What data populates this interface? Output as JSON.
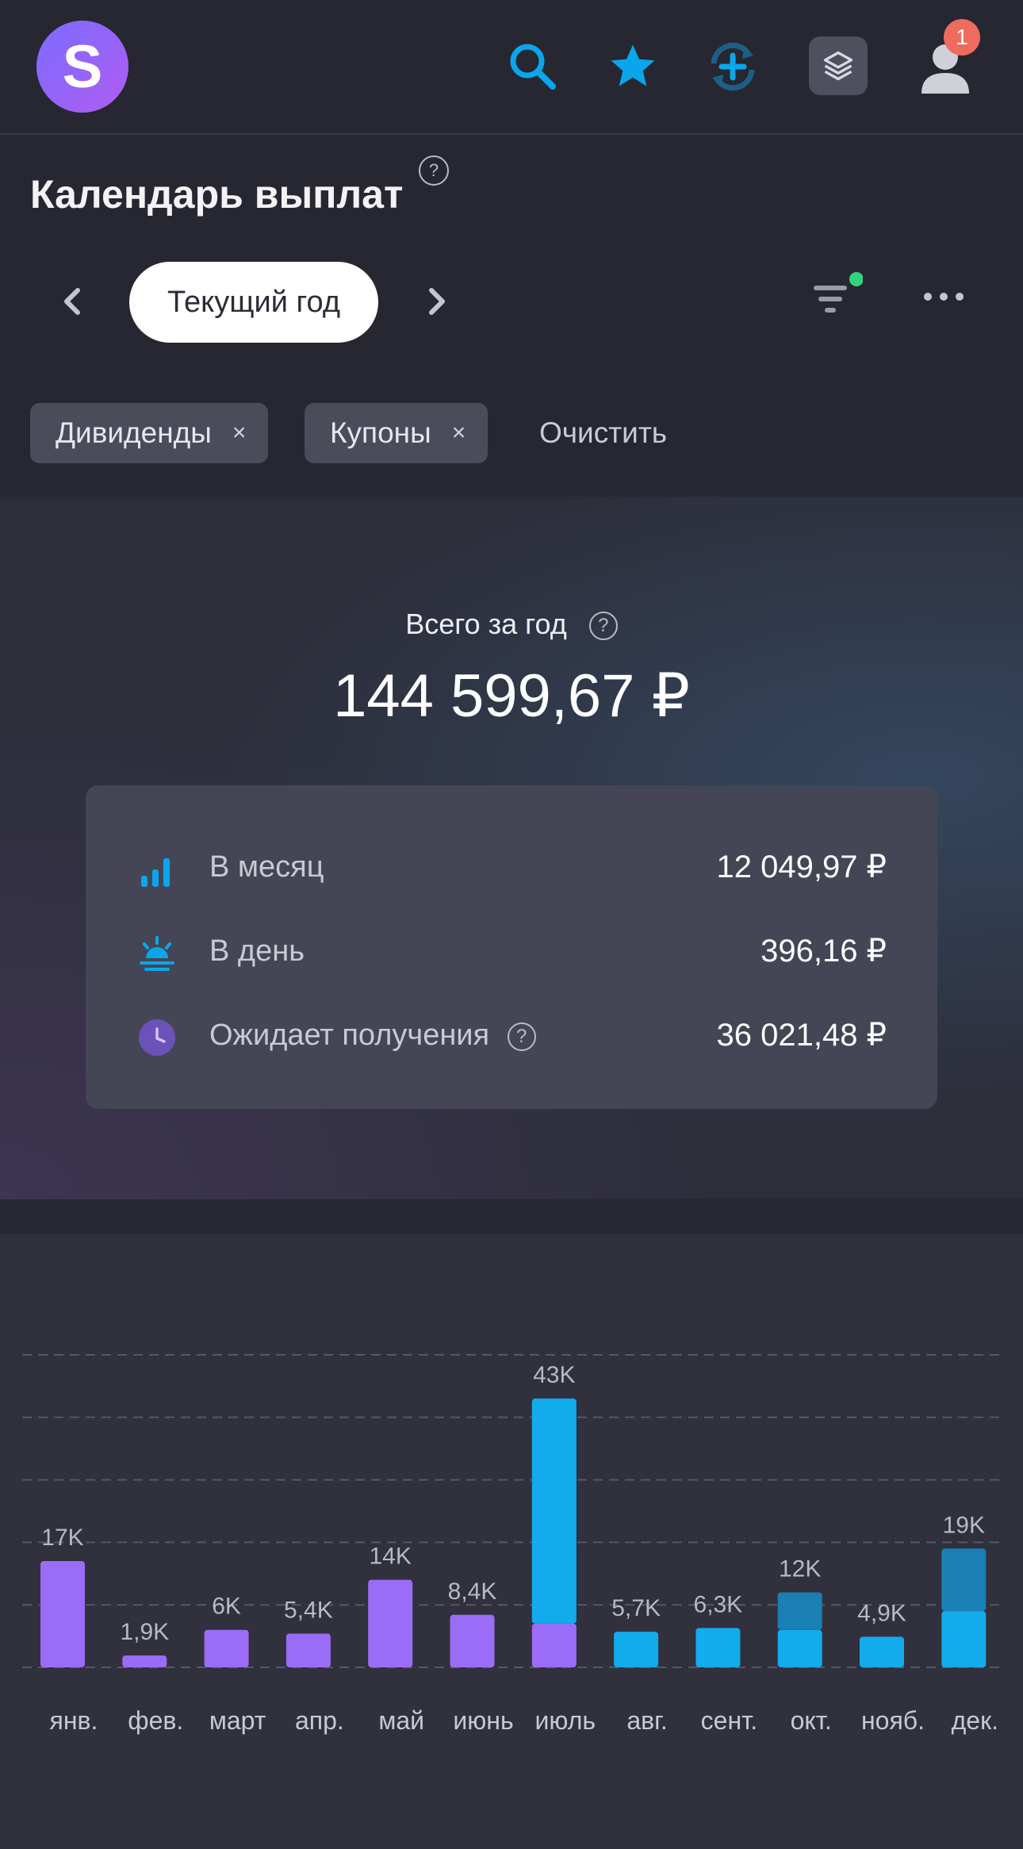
{
  "topbar": {
    "logo_letter": "S",
    "icons": [
      "search-icon",
      "star-icon",
      "add-sync-icon",
      "layers-icon",
      "user-icon"
    ],
    "notification_count": "1",
    "accent": "#0aa6ec"
  },
  "header": {
    "title": "Календарь выплат",
    "help": "?",
    "period": "Текущий год",
    "filter_active_color": "#35d07f"
  },
  "filters": {
    "chips": [
      {
        "label": "Дивиденды",
        "remove": "×"
      },
      {
        "label": "Купоны",
        "remove": "×"
      }
    ],
    "clear_label": "Очистить"
  },
  "summary": {
    "total_label": "Всего за год",
    "total_value": "144 599,67 ₽",
    "stats": [
      {
        "icon": "bar-chart-icon",
        "label": "В месяц",
        "value": "12 049,97 ₽"
      },
      {
        "icon": "sunrise-icon",
        "label": "В день",
        "value": "396,16 ₽"
      },
      {
        "icon": "clock-icon",
        "label": "Ожидает получения",
        "value": "36 021,48 ₽",
        "help": "?"
      }
    ]
  },
  "chart_data": {
    "type": "bar",
    "stacked": true,
    "grid": true,
    "categories": [
      "янв.",
      "фев.",
      "март",
      "апр.",
      "май",
      "июнь",
      "июль",
      "авг.",
      "сент.",
      "окт.",
      "нояб.",
      "дек."
    ],
    "labels": [
      "17K",
      "1,9K",
      "6K",
      "5,4K",
      "14K",
      "8,4K",
      "43K",
      "5,7K",
      "6,3K",
      "12K",
      "4,9K",
      "19K"
    ],
    "series": [
      {
        "color": "#9b6cf5",
        "values": [
          17,
          1.9,
          6,
          5.4,
          14,
          8.4,
          7,
          0,
          0,
          0,
          0,
          0
        ]
      },
      {
        "color": "#12abec",
        "values": [
          0,
          0,
          0,
          0,
          0,
          0,
          36,
          5.7,
          6.3,
          6,
          4.9,
          9
        ]
      },
      {
        "color": "#1a7fb4",
        "values": [
          0,
          0,
          0,
          0,
          0,
          0,
          0,
          0,
          0,
          6,
          0,
          10
        ]
      }
    ],
    "ylim": [
      0,
      50
    ]
  }
}
